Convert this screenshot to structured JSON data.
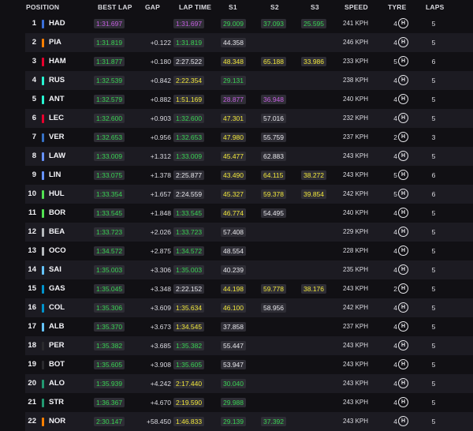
{
  "headers": {
    "position": "POSITION",
    "best_lap": "BEST LAP",
    "gap": "GAP",
    "lap_time": "LAP TIME",
    "s1": "S1",
    "s2": "S2",
    "s3": "S3",
    "speed": "SPEED",
    "tyre": "TYRE",
    "laps": "LAPS"
  },
  "colors": {
    "green": "#39d353",
    "yellow": "#f1e73b",
    "purple": "#c45fe0",
    "white": "#e6e6ea"
  },
  "rows": [
    {
      "pos": "1",
      "driver": "HAD",
      "team": "#3a6fd8",
      "best": "1:31.697",
      "best_c": "purple",
      "gap": "",
      "lap": "1:31.697",
      "lap_c": "purple",
      "s1": "29.009",
      "s1_c": "green",
      "s2": "37.093",
      "s2_c": "green",
      "s3": "25.595",
      "s3_c": "green",
      "speed": "241 KPH",
      "tyre_age": "4",
      "tyre": "H",
      "laps": "5"
    },
    {
      "pos": "2",
      "driver": "PIA",
      "team": "#ff8000",
      "best": "1:31.819",
      "best_c": "green",
      "gap": "+0.122",
      "lap": "1:31.819",
      "lap_c": "green",
      "s1": "44.358",
      "s1_c": "white",
      "s2": "",
      "s2_c": "white",
      "s3": "",
      "s3_c": "white",
      "speed": "246 KPH",
      "tyre_age": "4",
      "tyre": "H",
      "laps": "5"
    },
    {
      "pos": "3",
      "driver": "HAM",
      "team": "#e8002d",
      "best": "1:31.877",
      "best_c": "green",
      "gap": "+0.180",
      "lap": "2:27.522",
      "lap_c": "white",
      "s1": "48.348",
      "s1_c": "yellow",
      "s2": "65.188",
      "s2_c": "yellow",
      "s3": "33.986",
      "s3_c": "yellow",
      "speed": "233 KPH",
      "tyre_age": "5",
      "tyre": "H",
      "laps": "6"
    },
    {
      "pos": "4",
      "driver": "RUS",
      "team": "#27f4d2",
      "best": "1:32.539",
      "best_c": "green",
      "gap": "+0.842",
      "lap": "2:22.354",
      "lap_c": "yellow",
      "s1": "29.131",
      "s1_c": "green",
      "s2": "",
      "s2_c": "white",
      "s3": "",
      "s3_c": "white",
      "speed": "238 KPH",
      "tyre_age": "4",
      "tyre": "H",
      "laps": "5"
    },
    {
      "pos": "5",
      "driver": "ANT",
      "team": "#27f4d2",
      "best": "1:32.579",
      "best_c": "green",
      "gap": "+0.882",
      "lap": "1:51.169",
      "lap_c": "yellow",
      "s1": "28.877",
      "s1_c": "purple",
      "s2": "36.948",
      "s2_c": "purple",
      "s3": "",
      "s3_c": "white",
      "speed": "240 KPH",
      "tyre_age": "4",
      "tyre": "H",
      "laps": "5"
    },
    {
      "pos": "6",
      "driver": "LEC",
      "team": "#e8002d",
      "best": "1:32.600",
      "best_c": "green",
      "gap": "+0.903",
      "lap": "1:32.600",
      "lap_c": "green",
      "s1": "47.301",
      "s1_c": "yellow",
      "s2": "57.016",
      "s2_c": "white",
      "s3": "",
      "s3_c": "white",
      "speed": "232 KPH",
      "tyre_age": "4",
      "tyre": "H",
      "laps": "5"
    },
    {
      "pos": "7",
      "driver": "VER",
      "team": "#3671c6",
      "best": "1:32.653",
      "best_c": "green",
      "gap": "+0.956",
      "lap": "1:32.653",
      "lap_c": "green",
      "s1": "47.980",
      "s1_c": "yellow",
      "s2": "55.759",
      "s2_c": "white",
      "s3": "",
      "s3_c": "white",
      "speed": "237 KPH",
      "tyre_age": "2",
      "tyre": "H",
      "laps": "3"
    },
    {
      "pos": "8",
      "driver": "LAW",
      "team": "#6692ff",
      "best": "1:33.009",
      "best_c": "green",
      "gap": "+1.312",
      "lap": "1:33.009",
      "lap_c": "green",
      "s1": "45.477",
      "s1_c": "yellow",
      "s2": "62.883",
      "s2_c": "white",
      "s3": "",
      "s3_c": "white",
      "speed": "243 KPH",
      "tyre_age": "4",
      "tyre": "H",
      "laps": "5"
    },
    {
      "pos": "9",
      "driver": "LIN",
      "team": "#6692ff",
      "best": "1:33.075",
      "best_c": "green",
      "gap": "+1.378",
      "lap": "2:25.877",
      "lap_c": "white",
      "s1": "43.490",
      "s1_c": "yellow",
      "s2": "64.115",
      "s2_c": "yellow",
      "s3": "38.272",
      "s3_c": "yellow",
      "speed": "243 KPH",
      "tyre_age": "5",
      "tyre": "H",
      "laps": "6"
    },
    {
      "pos": "10",
      "driver": "HUL",
      "team": "#52e252",
      "best": "1:33.354",
      "best_c": "green",
      "gap": "+1.657",
      "lap": "2:24.559",
      "lap_c": "white",
      "s1": "45.327",
      "s1_c": "yellow",
      "s2": "59.378",
      "s2_c": "yellow",
      "s3": "39.854",
      "s3_c": "yellow",
      "speed": "242 KPH",
      "tyre_age": "5",
      "tyre": "H",
      "laps": "6"
    },
    {
      "pos": "11",
      "driver": "BOR",
      "team": "#52e252",
      "best": "1:33.545",
      "best_c": "green",
      "gap": "+1.848",
      "lap": "1:33.545",
      "lap_c": "green",
      "s1": "46.774",
      "s1_c": "yellow",
      "s2": "54.495",
      "s2_c": "white",
      "s3": "",
      "s3_c": "white",
      "speed": "240 KPH",
      "tyre_age": "4",
      "tyre": "H",
      "laps": "5"
    },
    {
      "pos": "12",
      "driver": "BEA",
      "team": "#b6babd",
      "best": "1:33.723",
      "best_c": "green",
      "gap": "+2.026",
      "lap": "1:33.723",
      "lap_c": "green",
      "s1": "57.408",
      "s1_c": "white",
      "s2": "",
      "s2_c": "white",
      "s3": "",
      "s3_c": "white",
      "speed": "229 KPH",
      "tyre_age": "4",
      "tyre": "H",
      "laps": "5"
    },
    {
      "pos": "13",
      "driver": "OCO",
      "team": "#b6babd",
      "best": "1:34.572",
      "best_c": "green",
      "gap": "+2.875",
      "lap": "1:34.572",
      "lap_c": "green",
      "s1": "48.554",
      "s1_c": "white",
      "s2": "",
      "s2_c": "white",
      "s3": "",
      "s3_c": "white",
      "speed": "228 KPH",
      "tyre_age": "4",
      "tyre": "H",
      "laps": "5"
    },
    {
      "pos": "14",
      "driver": "SAI",
      "team": "#64c4ff",
      "best": "1:35.003",
      "best_c": "green",
      "gap": "+3.306",
      "lap": "1:35.003",
      "lap_c": "green",
      "s1": "40.239",
      "s1_c": "white",
      "s2": "",
      "s2_c": "white",
      "s3": "",
      "s3_c": "white",
      "speed": "235 KPH",
      "tyre_age": "4",
      "tyre": "H",
      "laps": "5"
    },
    {
      "pos": "15",
      "driver": "GAS",
      "team": "#0093cc",
      "best": "1:35.045",
      "best_c": "green",
      "gap": "+3.348",
      "lap": "2:22.152",
      "lap_c": "white",
      "s1": "44.198",
      "s1_c": "yellow",
      "s2": "59.778",
      "s2_c": "yellow",
      "s3": "38.176",
      "s3_c": "yellow",
      "speed": "243 KPH",
      "tyre_age": "2",
      "tyre": "H",
      "laps": "5"
    },
    {
      "pos": "16",
      "driver": "COL",
      "team": "#0093cc",
      "best": "1:35.306",
      "best_c": "green",
      "gap": "+3.609",
      "lap": "1:35.634",
      "lap_c": "yellow",
      "s1": "46.100",
      "s1_c": "yellow",
      "s2": "58.956",
      "s2_c": "white",
      "s3": "",
      "s3_c": "white",
      "speed": "242 KPH",
      "tyre_age": "4",
      "tyre": "H",
      "laps": "5"
    },
    {
      "pos": "17",
      "driver": "ALB",
      "team": "#64c4ff",
      "best": "1:35.370",
      "best_c": "green",
      "gap": "+3.673",
      "lap": "1:34.545",
      "lap_c": "yellow",
      "s1": "37.858",
      "s1_c": "white",
      "s2": "",
      "s2_c": "white",
      "s3": "",
      "s3_c": "white",
      "speed": "237 KPH",
      "tyre_age": "4",
      "tyre": "H",
      "laps": "5"
    },
    {
      "pos": "18",
      "driver": "PER",
      "team": "#2a2a2e",
      "best": "1:35.382",
      "best_c": "green",
      "gap": "+3.685",
      "lap": "1:35.382",
      "lap_c": "green",
      "s1": "55.447",
      "s1_c": "white",
      "s2": "",
      "s2_c": "white",
      "s3": "",
      "s3_c": "white",
      "speed": "243 KPH",
      "tyre_age": "4",
      "tyre": "H",
      "laps": "5"
    },
    {
      "pos": "19",
      "driver": "BOT",
      "team": "#2a2a2e",
      "best": "1:35.605",
      "best_c": "green",
      "gap": "+3.908",
      "lap": "1:35.605",
      "lap_c": "green",
      "s1": "53.947",
      "s1_c": "white",
      "s2": "",
      "s2_c": "white",
      "s3": "",
      "s3_c": "white",
      "speed": "243 KPH",
      "tyre_age": "4",
      "tyre": "H",
      "laps": "5"
    },
    {
      "pos": "20",
      "driver": "ALO",
      "team": "#229971",
      "best": "1:35.939",
      "best_c": "green",
      "gap": "+4.242",
      "lap": "2:17.440",
      "lap_c": "yellow",
      "s1": "30.040",
      "s1_c": "green",
      "s2": "",
      "s2_c": "white",
      "s3": "",
      "s3_c": "white",
      "speed": "243 KPH",
      "tyre_age": "4",
      "tyre": "H",
      "laps": "5"
    },
    {
      "pos": "21",
      "driver": "STR",
      "team": "#229971",
      "best": "1:36.367",
      "best_c": "green",
      "gap": "+4.670",
      "lap": "2:19.590",
      "lap_c": "yellow",
      "s1": "29.988",
      "s1_c": "green",
      "s2": "",
      "s2_c": "white",
      "s3": "",
      "s3_c": "white",
      "speed": "243 KPH",
      "tyre_age": "4",
      "tyre": "H",
      "laps": "5"
    },
    {
      "pos": "22",
      "driver": "NOR",
      "team": "#ff8000",
      "best": "2:30.147",
      "best_c": "green",
      "gap": "+58.450",
      "lap": "1:46.833",
      "lap_c": "yellow",
      "s1": "29.139",
      "s1_c": "green",
      "s2": "37.392",
      "s2_c": "green",
      "s3": "",
      "s3_c": "white",
      "speed": "243 KPH",
      "tyre_age": "4",
      "tyre": "H",
      "laps": "5"
    }
  ]
}
